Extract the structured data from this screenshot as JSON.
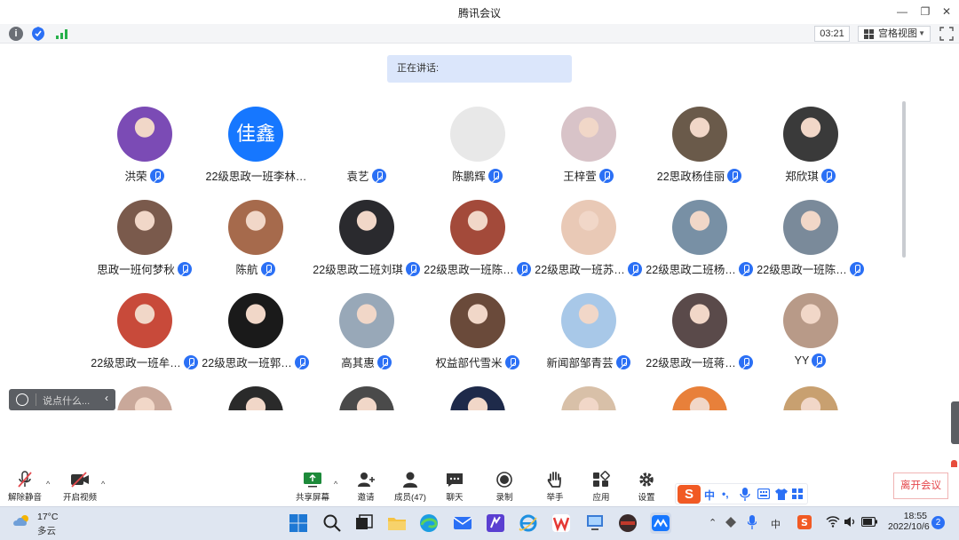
{
  "window": {
    "title": "腾讯会议"
  },
  "toolbar": {
    "timer": "03:21",
    "view_mode": "宫格视图"
  },
  "speaking": {
    "label": "正在讲话:"
  },
  "participants": [
    {
      "name": "洪荣",
      "avatar": "photo",
      "color": "#7b4bb5"
    },
    {
      "name": "22级思政一班李林…",
      "avatar": "text",
      "avatar_text": "佳鑫",
      "color": "#1677ff",
      "no_badge": true
    },
    {
      "name": "袁艺",
      "avatar": "plain",
      "color": "#ffffff"
    },
    {
      "name": "陈鹏辉",
      "avatar": "plain",
      "color": "#e8e8e8"
    },
    {
      "name": "王梓萱",
      "avatar": "photo",
      "color": "#d8c3c8"
    },
    {
      "name": "22思政杨佳丽",
      "avatar": "photo",
      "color": "#6a5a4a"
    },
    {
      "name": "郑欣琪",
      "avatar": "photo",
      "color": "#3a3a3a"
    },
    {
      "name": "思政一班何梦秋",
      "avatar": "photo",
      "color": "#7a5a4c"
    },
    {
      "name": "陈航",
      "avatar": "photo",
      "color": "#a66a4c"
    },
    {
      "name": "22级思政二班刘琪",
      "avatar": "photo",
      "color": "#2a2a2e"
    },
    {
      "name": "22级思政一班陈…",
      "avatar": "photo",
      "color": "#a34a3a"
    },
    {
      "name": "22级思政一班苏…",
      "avatar": "photo",
      "color": "#e9c9b6"
    },
    {
      "name": "22级思政二班杨…",
      "avatar": "photo",
      "color": "#7890a5"
    },
    {
      "name": "22级思政一班陈…",
      "avatar": "photo",
      "color": "#7a8a9a"
    },
    {
      "name": "22级思政一班牟…",
      "avatar": "photo",
      "color": "#c84a3a"
    },
    {
      "name": "22级思政一班郭…",
      "avatar": "photo",
      "color": "#1a1a1a"
    },
    {
      "name": "高其惠",
      "avatar": "photo",
      "color": "#98a8b8"
    },
    {
      "name": "权益部代雪米",
      "avatar": "photo",
      "color": "#6a4a3a"
    },
    {
      "name": "新闻部邹青芸",
      "avatar": "photo",
      "color": "#a8c8e8"
    },
    {
      "name": "22级思政一班蒋…",
      "avatar": "photo",
      "color": "#5a4a4a"
    },
    {
      "name": "YY",
      "avatar": "photo",
      "color": "#b89a88"
    },
    {
      "name": "",
      "avatar": "photo",
      "color": "#c9a89a",
      "partial": true
    },
    {
      "name": "",
      "avatar": "photo",
      "color": "#2a2a2a",
      "partial": true
    },
    {
      "name": "",
      "avatar": "photo",
      "color": "#4a4a4a",
      "partial": true
    },
    {
      "name": "",
      "avatar": "photo",
      "color": "#1e2a4a",
      "partial": true
    },
    {
      "name": "",
      "avatar": "photo",
      "color": "#d8c0a8",
      "partial": true
    },
    {
      "name": "",
      "avatar": "photo",
      "color": "#e8803a",
      "partial": true
    },
    {
      "name": "",
      "avatar": "photo",
      "color": "#c8a070",
      "partial": true
    }
  ],
  "chat": {
    "placeholder": "说点什么..."
  },
  "controls": {
    "mute": "解除静音",
    "video": "开启视频",
    "share": "共享屏幕",
    "invite": "邀请",
    "members": "成员(47)",
    "chat": "聊天",
    "record": "录制",
    "raise_hand": "举手",
    "apps": "应用",
    "settings": "设置",
    "leave": "离开会议"
  },
  "ime": {
    "lang": "中",
    "punct": "•,",
    "logo": "S"
  },
  "taskbar": {
    "temperature": "17°C",
    "condition": "多云",
    "time": "18:55",
    "date": "2022/10/6",
    "notifications": "2",
    "input_lang": "中"
  }
}
